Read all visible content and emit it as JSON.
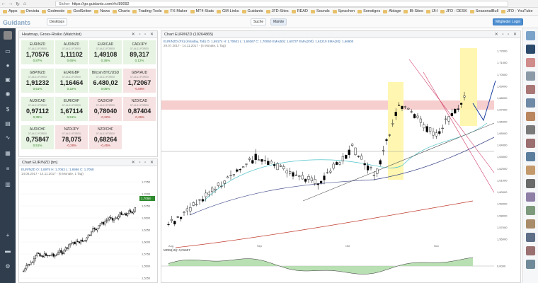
{
  "browser": {
    "url": "https://go.guidants.com/#c/89092",
    "secure_label": "Sicher",
    "bookmarks": [
      "Apps",
      "Onvista",
      "Godmode",
      "GodSeiten",
      "News",
      "Charts",
      "Trading-Tools",
      "FX-Maker",
      "MT4-Stats",
      "GM-Links",
      "Guidants",
      "JFD-Sites",
      "READ",
      "Sounds",
      "Sprachen",
      "Sonstiges",
      "Ablage",
      "IB-Sites",
      "IJH",
      "JFD - DESK",
      "SeasonalBull",
      "JFD - YouTube"
    ]
  },
  "app": {
    "logo": "Guidants",
    "desktop_button": "Desktops",
    "search_button": "Suche",
    "markets_button": "Märkte",
    "member_button": "Mitglieder Login"
  },
  "watchlist": {
    "title": "Heatmap, Gross-Risiko (Watchlist)",
    "tiles": [
      {
        "symbol": "EUR/NZD",
        "time": "07.44.11 FOREX",
        "price": "1,70576",
        "change": "0,87%",
        "trend": "up"
      },
      {
        "symbol": "AUD/NZD",
        "time": "07.44.11 FOREX",
        "price": "1,11102",
        "change": "0,65%",
        "trend": "up"
      },
      {
        "symbol": "EUR/CAD",
        "time": "07.44.11 FOREX",
        "price": "1,49108",
        "change": "0,36%",
        "trend": "up"
      },
      {
        "symbol": "CAD/JPY",
        "time": "07.44.11 FOREX",
        "price": "89,317",
        "change": "0,12%",
        "trend": "up"
      },
      {
        "symbol": "GBP/NZD",
        "time": "07.44.11 FOREX",
        "price": "1,91232",
        "change": "0,61%",
        "trend": "up"
      },
      {
        "symbol": "EUR/GBP",
        "time": "07.44.11 FOREX",
        "price": "1,16464",
        "change": "0,22%",
        "trend": "up"
      },
      {
        "symbol": "Bitcoin BTC/USD",
        "time": "07.44.11 FOREX",
        "price": "6.480,02",
        "change": "0,06%",
        "trend": "up"
      },
      {
        "symbol": "GBP/AUD",
        "time": "07.44.11 FOREX",
        "price": "1,72067",
        "change": "-0,08%",
        "trend": "down"
      },
      {
        "symbol": "AUD/CAD",
        "time": "07.44.11 FOREX",
        "price": "0,97112",
        "change": "0,35%",
        "trend": "up"
      },
      {
        "symbol": "EUR/CHF",
        "time": "07.44.11 FOREX",
        "price": "1,67114",
        "change": "0,51%",
        "trend": "up"
      },
      {
        "symbol": "CAD/CHF",
        "time": "07.44.11 FOREX",
        "price": "0,78040",
        "change": "-0,32%",
        "trend": "down"
      },
      {
        "symbol": "NZD/CAD",
        "time": "07.44.11 FOREX",
        "price": "0,87404",
        "change": "-0,36%",
        "trend": "down"
      },
      {
        "symbol": "AUD/CHF",
        "time": "07.44.11 FOREX",
        "price": "0,75847",
        "change": "0,51%",
        "trend": "up"
      },
      {
        "symbol": "NZD/JPY",
        "time": "07.44.11 FOREX",
        "price": "78,075",
        "change": "-0,28%",
        "trend": "down"
      },
      {
        "symbol": "NZD/CHF",
        "time": "07.44.11 FOREX",
        "price": "0,68264",
        "change": "-0,45%",
        "trend": "down"
      }
    ]
  },
  "small_chart": {
    "title": "Chart EUR/NZD [tm]",
    "info_line1": "EUR/NZD  O: 1,6975  H: 1,7063  L: 1,6966  C: 1,7058",
    "info_line2": "14.05.2017 - 14.11.2017 - (6 Monate, 1 Tag)",
    "last_price": "1,7058",
    "y_labels": [
      "1,7250",
      "1,7000",
      "1,6750",
      "1,6500",
      "1,6250",
      "1,6000",
      "1,5750",
      "1,5500",
      "1,5250"
    ]
  },
  "main_chart": {
    "title": "Chart EUR/NZD (19264865)",
    "info_line1": "EUR/NZD (FX) (Intraday, Tab)  O: 1,69174  H: 1,70601  L: 1,69367  C: 1,70060  EMA(50): 1,60737  EMA(200): 1,61210  EMA(20): 1,66900",
    "info_line2": "29.07.2017 - 14.11.2017 - (4 Monate, 1 Tag)",
    "x_labels": [
      "Aug",
      "Sep",
      "Okt",
      "Nov"
    ],
    "y_labels": [
      "1,72000",
      "1,71000",
      "1,70000",
      "1,69000",
      "1,68000",
      "1,67000",
      "1,66000",
      "1,65000",
      "1,64000",
      "1,63000",
      "1,62000",
      "1,61000",
      "1,60000",
      "1,59000",
      "1,58000",
      "1,57000",
      "1,56000"
    ],
    "mom_label": "MOM(15): 0,01607",
    "mom_y": "0,0000"
  }
}
